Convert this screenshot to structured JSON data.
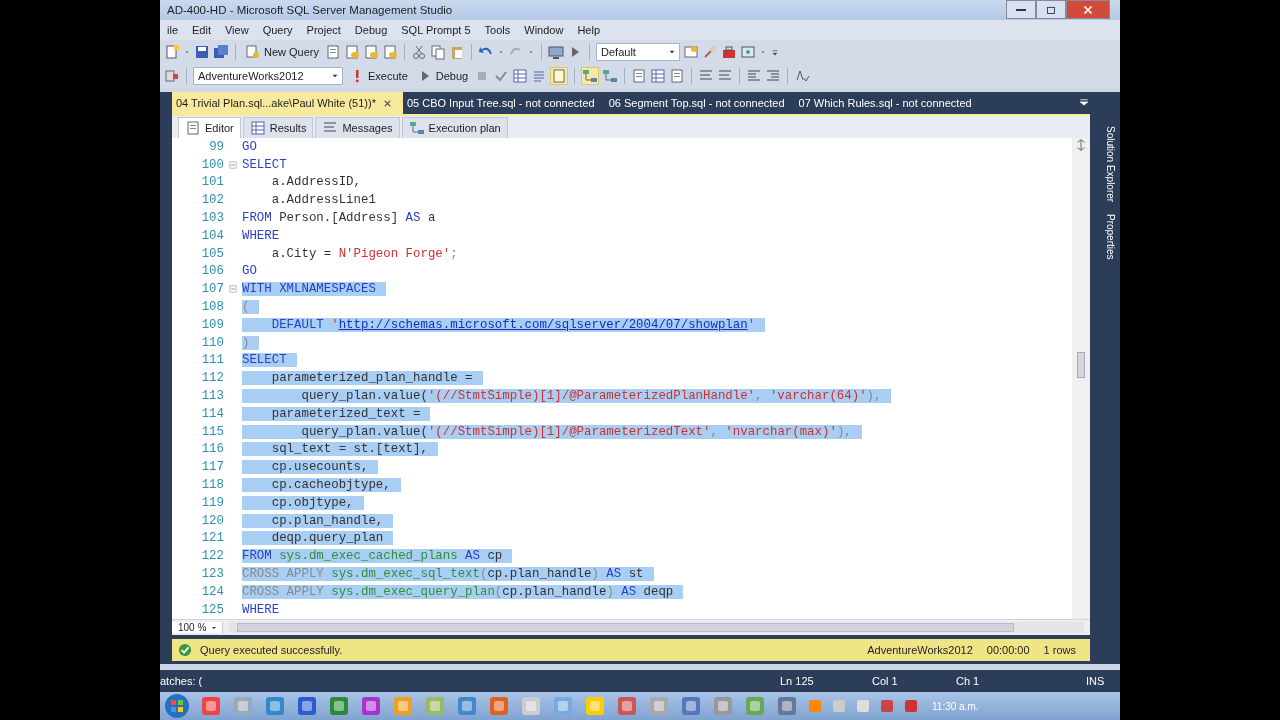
{
  "window": {
    "title": "AD-400-HD - Microsoft SQL Server Management Studio"
  },
  "menu": [
    "ile",
    "Edit",
    "View",
    "Query",
    "Project",
    "Debug",
    "SQL Prompt 5",
    "Tools",
    "Window",
    "Help"
  ],
  "toolbar": {
    "new_query": "New Query",
    "configuration": "Default"
  },
  "query_toolbar": {
    "database": "AdventureWorks2012",
    "execute": "Execute",
    "debug": "Debug"
  },
  "document_tabs": [
    {
      "label": "04 Trivial Plan.sql...ake\\Paul White (51))*",
      "selected": true
    },
    {
      "label": "05 CBO Input Tree.sql - not connected",
      "selected": false
    },
    {
      "label": "06 Segment Top.sql - not connected",
      "selected": false
    },
    {
      "label": "07 Which Rules.sql - not connected",
      "selected": false
    }
  ],
  "editor_tabs": [
    {
      "label": "Editor",
      "selected": true
    },
    {
      "label": "Results",
      "selected": false
    },
    {
      "label": "Messages",
      "selected": false
    },
    {
      "label": "Execution plan",
      "selected": false
    }
  ],
  "editor": {
    "lines": [
      {
        "number": "99",
        "fold": false,
        "selected": false,
        "tokens": [
          {
            "kind": "keyword",
            "text": "GO"
          }
        ]
      },
      {
        "number": "100",
        "fold": true,
        "selected": false,
        "tokens": [
          {
            "kind": "keyword",
            "text": "SELECT"
          }
        ]
      },
      {
        "number": "101",
        "fold": false,
        "selected": false,
        "tokens": [
          {
            "kind": "plain",
            "text": "    a.AddressID,"
          }
        ]
      },
      {
        "number": "102",
        "fold": false,
        "selected": false,
        "tokens": [
          {
            "kind": "plain",
            "text": "    a.AddressLine1"
          }
        ]
      },
      {
        "number": "103",
        "fold": false,
        "selected": false,
        "tokens": [
          {
            "kind": "keyword",
            "text": "FROM"
          },
          {
            "kind": "plain",
            "text": " Person.[Address] "
          },
          {
            "kind": "keyword",
            "text": "AS"
          },
          {
            "kind": "plain",
            "text": " a"
          }
        ]
      },
      {
        "number": "104",
        "fold": false,
        "selected": false,
        "tokens": [
          {
            "kind": "keyword",
            "text": "WHERE"
          }
        ]
      },
      {
        "number": "105",
        "fold": false,
        "selected": false,
        "tokens": [
          {
            "kind": "plain",
            "text": "    a.City = "
          },
          {
            "kind": "string",
            "text": "N'Pigeon Forge'"
          },
          {
            "kind": "operator",
            "text": ";"
          }
        ]
      },
      {
        "number": "106",
        "fold": false,
        "selected": false,
        "tokens": [
          {
            "kind": "keyword",
            "text": "GO"
          }
        ]
      },
      {
        "number": "107",
        "fold": true,
        "selected": true,
        "tokens": [
          {
            "kind": "keyword",
            "text": "WITH XMLNAMESPACES"
          }
        ]
      },
      {
        "number": "108",
        "fold": false,
        "selected": true,
        "tokens": [
          {
            "kind": "operator",
            "text": "("
          }
        ]
      },
      {
        "number": "109",
        "fold": false,
        "selected": true,
        "tokens": [
          {
            "kind": "keyword",
            "text": "    DEFAULT"
          },
          {
            "kind": "string",
            "text": " '"
          },
          {
            "kind": "url",
            "text": "http://schemas.microsoft.com/sqlserver/2004/07/showplan"
          },
          {
            "kind": "string",
            "text": "'"
          }
        ]
      },
      {
        "number": "110",
        "fold": false,
        "selected": true,
        "tokens": [
          {
            "kind": "operator",
            "text": ")"
          }
        ]
      },
      {
        "number": "111",
        "fold": false,
        "selected": true,
        "tokens": [
          {
            "kind": "keyword",
            "text": "SELECT"
          }
        ]
      },
      {
        "number": "112",
        "fold": false,
        "selected": true,
        "tokens": [
          {
            "kind": "plain",
            "text": "    parameterized_plan_handle ="
          }
        ]
      },
      {
        "number": "113",
        "fold": false,
        "selected": true,
        "tokens": [
          {
            "kind": "plain",
            "text": "        query_plan.value("
          },
          {
            "kind": "string",
            "text": "'(//StmtSimple)[1]/@ParameterizedPlanHandle'"
          },
          {
            "kind": "operator",
            "text": ", "
          },
          {
            "kind": "string",
            "text": "'varchar(64)'"
          },
          {
            "kind": "operator",
            "text": "),"
          }
        ]
      },
      {
        "number": "114",
        "fold": false,
        "selected": true,
        "tokens": [
          {
            "kind": "plain",
            "text": "    parameterized_text ="
          }
        ]
      },
      {
        "number": "115",
        "fold": false,
        "selected": true,
        "tokens": [
          {
            "kind": "plain",
            "text": "        query_plan.value("
          },
          {
            "kind": "string",
            "text": "'(//StmtSimple)[1]/@ParameterizedText'"
          },
          {
            "kind": "operator",
            "text": ", "
          },
          {
            "kind": "string",
            "text": "'nvarchar(max)'"
          },
          {
            "kind": "operator",
            "text": "),"
          }
        ]
      },
      {
        "number": "116",
        "fold": false,
        "selected": true,
        "tokens": [
          {
            "kind": "plain",
            "text": "    sql_text = st.[text],"
          }
        ]
      },
      {
        "number": "117",
        "fold": false,
        "selected": true,
        "tokens": [
          {
            "kind": "plain",
            "text": "    cp.usecounts,"
          }
        ]
      },
      {
        "number": "118",
        "fold": false,
        "selected": true,
        "tokens": [
          {
            "kind": "plain",
            "text": "    cp.cacheobjtype,"
          }
        ]
      },
      {
        "number": "119",
        "fold": false,
        "selected": true,
        "tokens": [
          {
            "kind": "plain",
            "text": "    cp.objtype,"
          }
        ]
      },
      {
        "number": "120",
        "fold": false,
        "selected": true,
        "tokens": [
          {
            "kind": "plain",
            "text": "    cp.plan_handle,"
          }
        ]
      },
      {
        "number": "121",
        "fold": false,
        "selected": true,
        "tokens": [
          {
            "kind": "plain",
            "text": "    deqp.query_plan"
          }
        ]
      },
      {
        "number": "122",
        "fold": false,
        "selected": true,
        "tokens": [
          {
            "kind": "keyword",
            "text": "FROM"
          },
          {
            "kind": "system",
            "text": " sys.dm_exec_cached_plans "
          },
          {
            "kind": "keyword",
            "text": "AS"
          },
          {
            "kind": "plain",
            "text": " cp"
          }
        ]
      },
      {
        "number": "123",
        "fold": false,
        "selected": true,
        "tokens": [
          {
            "kind": "operator",
            "text": "CROSS APPLY"
          },
          {
            "kind": "system",
            "text": " sys.dm_exec_sql_text"
          },
          {
            "kind": "operator",
            "text": "("
          },
          {
            "kind": "plain",
            "text": "cp.plan_handle"
          },
          {
            "kind": "operator",
            "text": ")"
          },
          {
            "kind": "keyword",
            "text": " AS"
          },
          {
            "kind": "plain",
            "text": " st"
          }
        ]
      },
      {
        "number": "124",
        "fold": false,
        "selected": true,
        "tokens": [
          {
            "kind": "operator",
            "text": "CROSS APPLY"
          },
          {
            "kind": "system",
            "text": " sys.dm_exec_query_plan"
          },
          {
            "kind": "operator",
            "text": "("
          },
          {
            "kind": "plain",
            "text": "cp.plan_handle"
          },
          {
            "kind": "operator",
            "text": ")"
          },
          {
            "kind": "keyword",
            "text": " AS"
          },
          {
            "kind": "plain",
            "text": " deqp"
          }
        ]
      },
      {
        "number": "125",
        "fold": false,
        "selected": false,
        "tokens": [
          {
            "kind": "keyword",
            "text": "WHERE"
          }
        ]
      }
    ]
  },
  "zoom": "100 %",
  "query_status": {
    "message": "Query executed successfully.",
    "database": "AdventureWorks2012",
    "elapsed": "00:00:00",
    "rows": "1 rows"
  },
  "side_panels": [
    "Solution Explorer",
    "Properties"
  ],
  "status_bar": {
    "left": "atches: (",
    "line": "Ln 125",
    "column": "Col 1",
    "char": "Ch 1",
    "mode": "INS"
  },
  "taskbar": {
    "clock": "11:30 a.m."
  }
}
